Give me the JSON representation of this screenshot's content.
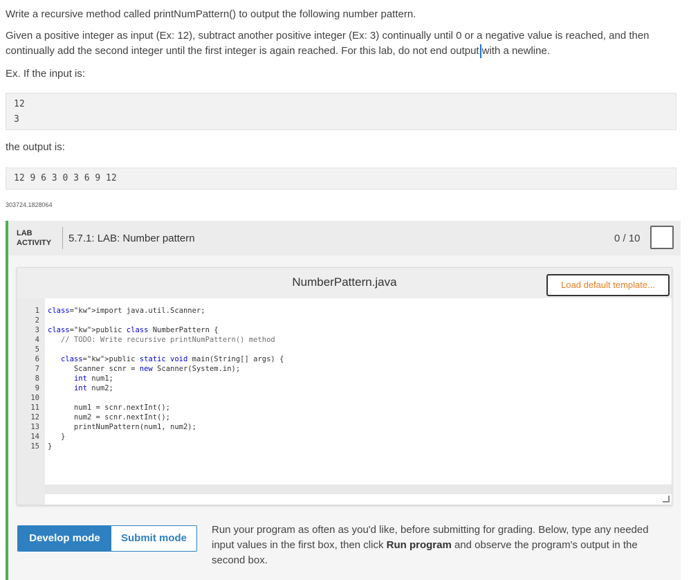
{
  "instructions": {
    "line1": "Write a recursive method called printNumPattern() to output the following number pattern.",
    "line2a": "Given a positive integer as input (Ex: 12), subtract another positive integer (Ex: 3) continually until 0 or a negative value is reached, and then continually add the second integer until the first integer is again reached. For this lab, do not end output",
    "line2b": "with a newline.",
    "line3": "Ex. If the input is:",
    "input_lines": [
      "12",
      "3"
    ],
    "output_label": "the output is:",
    "output_value": "12 9 6 3 0 3 6 9 12",
    "identifier": "303724.1828064"
  },
  "lab": {
    "tag_line1": "LAB",
    "tag_line2": "ACTIVITY",
    "title": "5.7.1: LAB: Number pattern",
    "score": "0 / 10",
    "accent_color": "#4caf50"
  },
  "editor": {
    "filename": "NumberPattern.java",
    "load_button": "Load default template...",
    "line_numbers": [
      "1",
      "2",
      "3",
      "4",
      "5",
      "6",
      "7",
      "8",
      "9",
      "10",
      "11",
      "12",
      "13",
      "14",
      "15"
    ],
    "code": [
      "import java.util.Scanner;",
      "",
      "public class NumberPattern {",
      "   // TODO: Write recursive printNumPattern() method",
      "",
      "   public static void main(String[] args) {",
      "      Scanner scnr = new Scanner(System.in);",
      "      int num1;",
      "      int num2;",
      "",
      "      num1 = scnr.nextInt();",
      "      num2 = scnr.nextInt();",
      "      printNumPattern(num1, num2);",
      "   }",
      "}"
    ]
  },
  "modes": {
    "develop": "Develop mode",
    "submit": "Submit mode",
    "active_color": "#2f80c1"
  },
  "run_info": {
    "part1": "Run your program as often as you'd like, before submitting for grading. Below, type any needed input values in the first box, then click ",
    "bold1": "Run program",
    "part2": " and observe the program's output in the second box."
  }
}
